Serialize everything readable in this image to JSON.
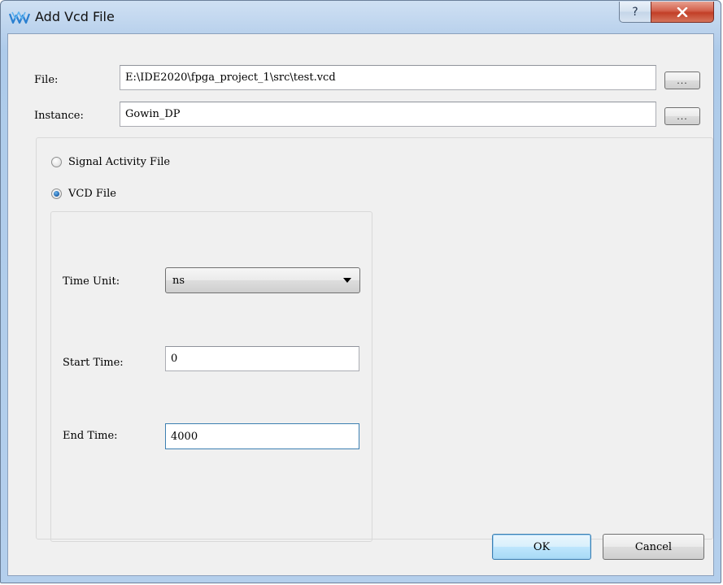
{
  "window": {
    "title": "Add Vcd File",
    "help_label": "?",
    "close_label": "x"
  },
  "file": {
    "label": "File:",
    "value": "E:\\IDE2020\\fpga_project_1\\src\\test.vcd",
    "browse_label": "..."
  },
  "instance": {
    "label": "Instance:",
    "value": "Gowin_DP",
    "browse_label": "..."
  },
  "mode": {
    "options": [
      {
        "label": "Signal Activity File",
        "checked": false
      },
      {
        "label": "VCD File",
        "checked": true
      }
    ]
  },
  "vcd": {
    "time_unit_label": "Time Unit:",
    "time_unit_value": "ns",
    "start_time_label": "Start Time:",
    "start_time_value": "0",
    "end_time_label": "End Time:",
    "end_time_value": "4000"
  },
  "buttons": {
    "ok_label": "OK",
    "cancel_label": "Cancel"
  },
  "colors": {
    "close_button": "#c23f27",
    "accent_border": "#3c7fb1",
    "dialog_background": "#f0f0f0"
  }
}
